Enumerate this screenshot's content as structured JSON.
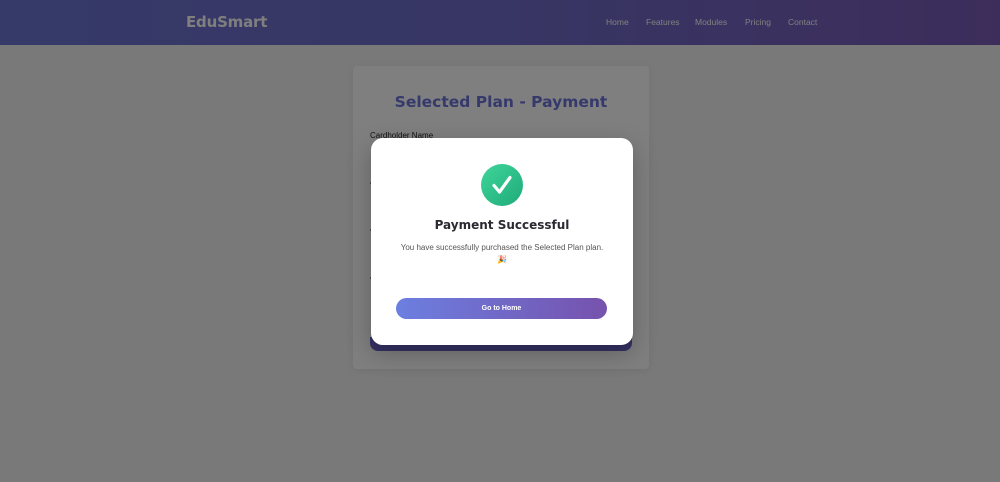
{
  "header": {
    "brand": "EduSmart",
    "nav": [
      "Home",
      "Features",
      "Modules",
      "Pricing",
      "Contact"
    ]
  },
  "payment_card": {
    "title": "Selected Plan - Payment",
    "cardholder_label": "Cardholder Name"
  },
  "modal": {
    "title": "Payment Successful",
    "message": "You have successfully purchased the Selected Plan plan.",
    "emoji": "🎉",
    "button_label": "Go to Home"
  },
  "colors": {
    "nav_gradient_start": "#6d75d2",
    "nav_gradient_end": "#7a5bb6",
    "title_accent": "#6a72d8",
    "success_green": "#1faa7a",
    "button_gradient_start": "#6c7fe0",
    "button_gradient_end": "#7652ad"
  }
}
